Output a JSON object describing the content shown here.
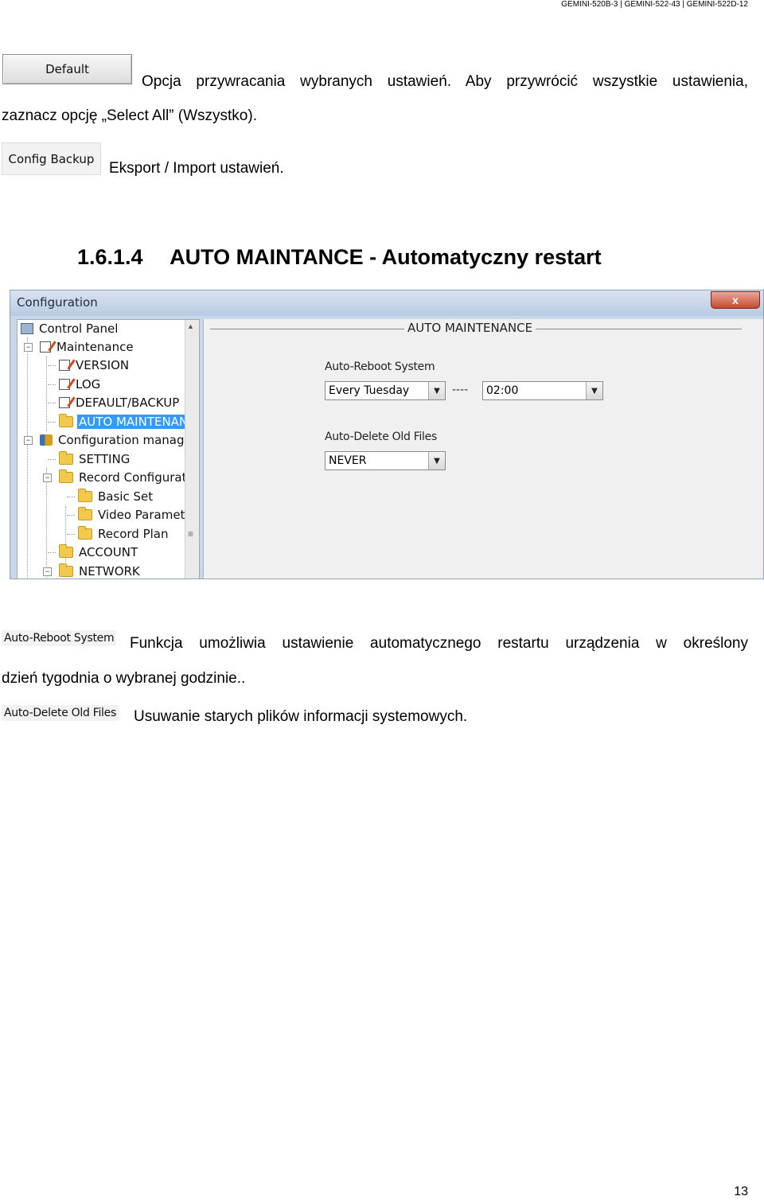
{
  "header": {
    "models": "GEMINI-520B-3 | GEMINI-522-43 | GEMINI-522D-12"
  },
  "default_button": {
    "label": "Default"
  },
  "default_description": {
    "line1": "Opcja przywracania wybranych ustawień. Aby przywrócić wszystkie ustawienia,",
    "line2": "zaznacz opcję „Select All” (Wszystko)."
  },
  "config_backup_button": {
    "label": "Config Backup"
  },
  "config_backup_description": "Eksport / Import ustawień.",
  "section": {
    "number": "1.6.1.4",
    "title": "AUTO MAINTANCE - Automatyczny restart"
  },
  "window": {
    "title": "Configuration",
    "close_symbol": "x",
    "tree": [
      {
        "label": "Control Panel"
      },
      {
        "label": "Maintenance"
      },
      {
        "label": "VERSION"
      },
      {
        "label": "LOG"
      },
      {
        "label": "DEFAULT/BACKUP"
      },
      {
        "label": "AUTO MAINTENANCE"
      },
      {
        "label": "Configuration manage"
      },
      {
        "label": "SETTING"
      },
      {
        "label": "Record Configurat"
      },
      {
        "label": "Basic Set"
      },
      {
        "label": "Video Paramete"
      },
      {
        "label": "Record Plan"
      },
      {
        "label": "ACCOUNT"
      },
      {
        "label": "NETWORK"
      }
    ],
    "panel": {
      "group_title": "AUTO MAINTENANCE",
      "auto_reboot_label": "Auto-Reboot System",
      "reboot_day": "Every Tuesday",
      "separator": "----",
      "reboot_time": "02:00",
      "auto_delete_label": "Auto-Delete Old Files",
      "delete_value": "NEVER"
    }
  },
  "auto_reboot_note": {
    "image_label": "Auto-Reboot System",
    "line1": "Funkcja umożliwia ustawienie automatycznego restartu urządzenia w określony",
    "line2": "dzień tygodnia o wybranej godzinie.."
  },
  "auto_delete_note": {
    "image_label": "Auto-Delete Old Files",
    "text": "Usuwanie starych plików informacji systemowych."
  },
  "page_number": "13"
}
